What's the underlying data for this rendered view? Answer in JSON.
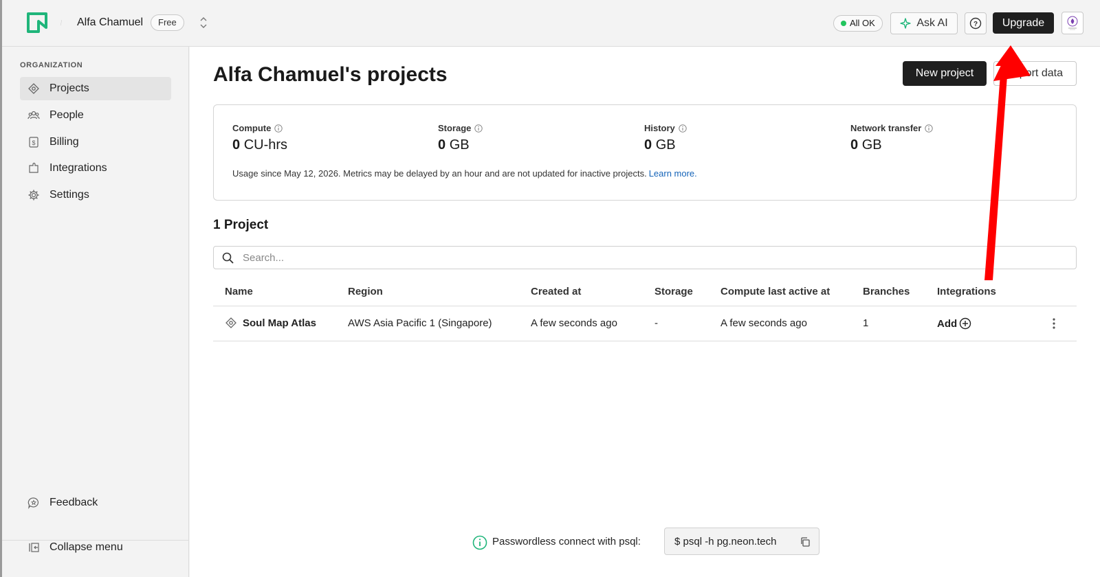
{
  "header": {
    "org_name": "Alfa Chamuel",
    "plan": "Free",
    "status": "All OK",
    "ask_ai": "Ask AI",
    "upgrade": "Upgrade"
  },
  "sidebar": {
    "section_title": "ORGANIZATION",
    "items": [
      {
        "label": "Projects",
        "icon": "projects-icon"
      },
      {
        "label": "People",
        "icon": "people-icon"
      },
      {
        "label": "Billing",
        "icon": "billing-icon"
      },
      {
        "label": "Integrations",
        "icon": "integrations-icon"
      },
      {
        "label": "Settings",
        "icon": "gear-icon"
      }
    ],
    "feedback": "Feedback",
    "collapse": "Collapse menu"
  },
  "main": {
    "title": "Alfa Chamuel's projects",
    "new_project": "New project",
    "import_data": "Import data",
    "usage": {
      "metrics": [
        {
          "label": "Compute",
          "value": "0",
          "unit": "CU-hrs"
        },
        {
          "label": "Storage",
          "value": "0",
          "unit": "GB"
        },
        {
          "label": "History",
          "value": "0",
          "unit": "GB"
        },
        {
          "label": "Network transfer",
          "value": "0",
          "unit": "GB"
        }
      ],
      "note": "Usage since May 12, 2026. Metrics may be delayed by an hour and are not updated for inactive projects.",
      "learn_more": "Learn more."
    },
    "project_count": "1 Project",
    "search_placeholder": "Search...",
    "table": {
      "columns": [
        "Name",
        "Region",
        "Created at",
        "Storage",
        "Compute last active at",
        "Branches",
        "Integrations"
      ],
      "rows": [
        {
          "name": "Soul Map Atlas",
          "region": "AWS Asia Pacific 1 (Singapore)",
          "created_at": "A few seconds ago",
          "storage": "-",
          "compute_last_active": "A few seconds ago",
          "branches": "1",
          "integrations": "Add"
        }
      ]
    },
    "psql": {
      "label": "Passwordless connect with psql:",
      "command": "$ psql -h pg.neon.tech"
    }
  },
  "colors": {
    "brand": "#1fb57a",
    "dark_button": "#1f1f1f",
    "link": "#1463b8",
    "status_ok": "#22c55e",
    "annotation_arrow": "#ff0000"
  }
}
